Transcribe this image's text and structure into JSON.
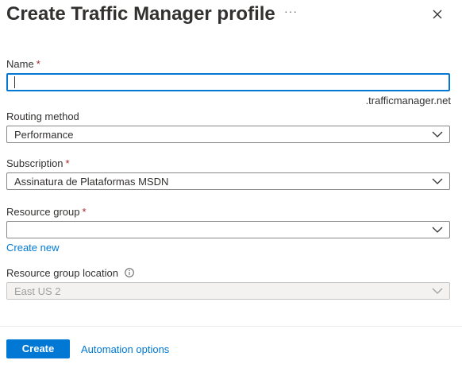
{
  "header": {
    "title": "Create Traffic Manager profile",
    "more_label": "···"
  },
  "form": {
    "name": {
      "label": "Name",
      "required_mark": "*",
      "value": "",
      "suffix": ".trafficmanager.net"
    },
    "routing": {
      "label": "Routing method",
      "value": "Performance"
    },
    "subscription": {
      "label": "Subscription",
      "required_mark": "*",
      "value": "Assinatura de Plataformas MSDN"
    },
    "resource_group": {
      "label": "Resource group",
      "required_mark": "*",
      "value": "",
      "create_new": "Create new"
    },
    "location": {
      "label": "Resource group location",
      "value": "East US 2"
    }
  },
  "footer": {
    "create_label": "Create",
    "automation_label": "Automation options"
  },
  "colors": {
    "accent": "#0078d4",
    "required": "#a4262c"
  },
  "icons": [
    "close-icon",
    "chevron-down-icon",
    "info-icon",
    "more-icon"
  ]
}
